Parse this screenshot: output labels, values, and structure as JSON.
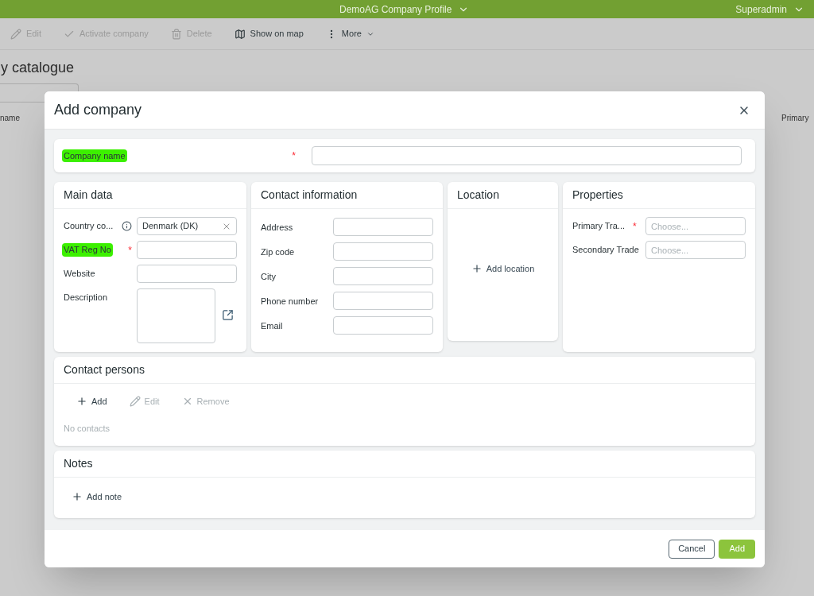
{
  "app_bar": {
    "title": "DemoAG Company Profile",
    "user": "Superadmin"
  },
  "toolbar": [
    {
      "label": "Edit",
      "disabled": true
    },
    {
      "label": "Activate company",
      "disabled": true
    },
    {
      "label": "Delete",
      "disabled": true
    },
    {
      "label": "Show on map",
      "disabled": false
    },
    {
      "label": "More",
      "disabled": false
    }
  ],
  "page_title": "y catalogue",
  "table_columns": [
    "name",
    "Primary"
  ],
  "required_mark": "*",
  "dialog": {
    "title": "Add company",
    "company_name": {
      "label": "Company name",
      "required": true,
      "highlighted": true
    },
    "main_data": {
      "title": "Main data",
      "fields": [
        {
          "label": "Country co...",
          "kind": "select",
          "value": "Denmark (DK)",
          "required": false,
          "highlighted": false,
          "info": true
        },
        {
          "label": "VAT Reg No",
          "kind": "text",
          "required": true,
          "highlighted": true,
          "info": false
        },
        {
          "label": "Website",
          "kind": "text",
          "required": false,
          "highlighted": false,
          "info": false
        },
        {
          "label": "Description",
          "kind": "textarea",
          "required": false,
          "highlighted": false,
          "info": false
        }
      ]
    },
    "contact_information": {
      "title": "Contact information",
      "fields": [
        {
          "label": "Address"
        },
        {
          "label": "Zip code"
        },
        {
          "label": "City"
        },
        {
          "label": "Phone number"
        },
        {
          "label": "Email"
        }
      ]
    },
    "location": {
      "title": "Location",
      "action": "Add location"
    },
    "properties": {
      "title": "Properties",
      "fields": [
        {
          "label": "Primary Tra...",
          "placeholder": "Choose...",
          "required": true
        },
        {
          "label": "Secondary Trade",
          "placeholder": "Choose...",
          "required": false
        }
      ]
    },
    "contact_persons": {
      "title": "Contact persons",
      "actions": [
        {
          "label": "Add",
          "disabled": false
        },
        {
          "label": "Edit",
          "disabled": true
        },
        {
          "label": "Remove",
          "disabled": true
        }
      ],
      "empty": "No contacts"
    },
    "notes": {
      "title": "Notes",
      "action": "Add note"
    },
    "buttons": [
      {
        "label": "Cancel",
        "kind": "secondary"
      },
      {
        "label": "Add",
        "kind": "primary"
      }
    ]
  }
}
